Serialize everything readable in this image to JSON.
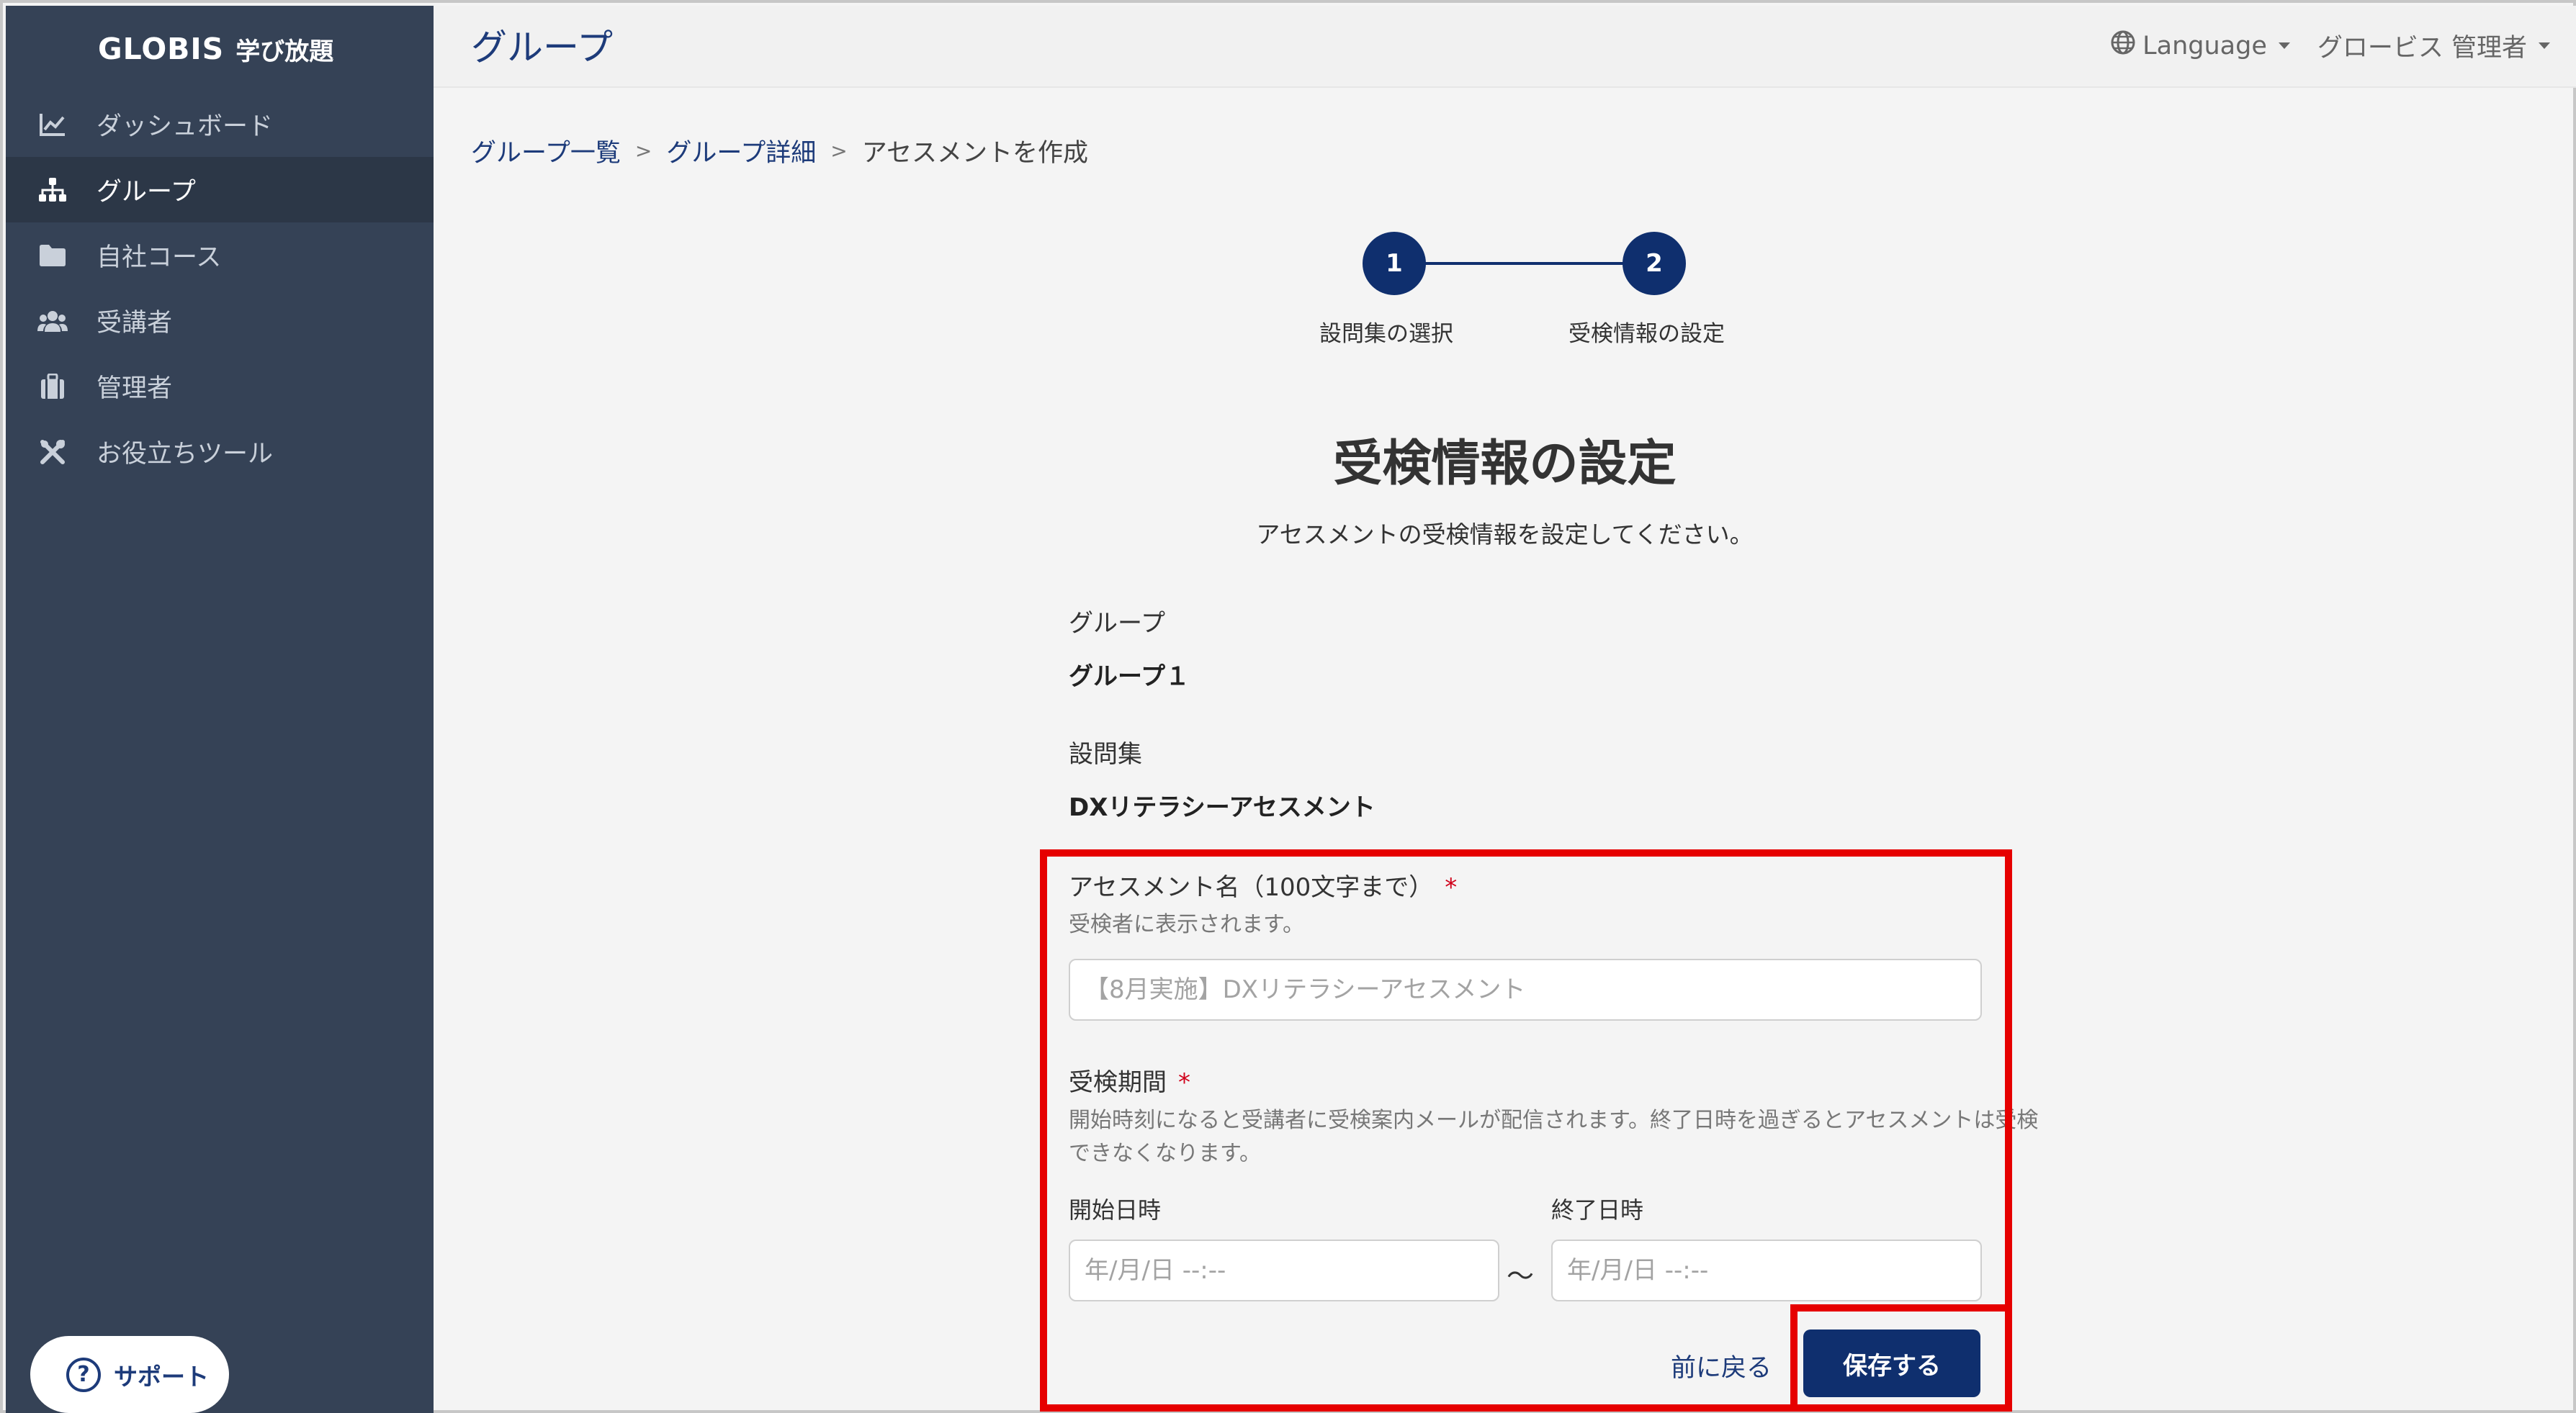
{
  "app": {
    "brand": "GLOBIS",
    "brand_sub": "学び放題"
  },
  "sidebar": {
    "items": [
      {
        "label": "ダッシュボード",
        "icon": "chart-line-icon",
        "active": false
      },
      {
        "label": "グループ",
        "icon": "sitemap-icon",
        "active": true
      },
      {
        "label": "自社コース",
        "icon": "folder-icon",
        "active": false
      },
      {
        "label": "受講者",
        "icon": "users-icon",
        "active": false
      },
      {
        "label": "管理者",
        "icon": "briefcase-icon",
        "active": false
      },
      {
        "label": "お役立ちツール",
        "icon": "tools-icon",
        "active": false
      }
    ],
    "support_label": "サポート"
  },
  "header": {
    "title": "グループ",
    "language_label": "Language",
    "user_label": "グロービス 管理者"
  },
  "breadcrumb": {
    "items": [
      "グループ一覧",
      "グループ詳細"
    ],
    "current": "アセスメントを作成",
    "separator": ">"
  },
  "stepper": {
    "steps": [
      {
        "number": "1",
        "label": "設問集の選択"
      },
      {
        "number": "2",
        "label": "受検情報の設定"
      }
    ]
  },
  "form": {
    "title": "受検情報の設定",
    "description": "アセスメントの受検情報を設定してください。",
    "group_label": "グループ",
    "group_value": "グループ１",
    "question_set_label": "設問集",
    "question_set_value": "DXリテラシーアセスメント",
    "assessment_name_label": "アセスメント名（100文字まで）",
    "required_mark": "*",
    "assessment_name_hint": "受検者に表示されます。",
    "assessment_name_placeholder": "【8月実施】DXリテラシーアセスメント",
    "period_label": "受検期間",
    "period_hint_line1": "開始時刻になると受講者に受検案内メールが配信されます。終了日時を過ぎるとアセスメントは受検",
    "period_hint_line2": "できなくなります。",
    "start_label": "開始日時",
    "end_label": "終了日時",
    "datetime_placeholder": "年/月/日 --:--",
    "range_separator": "～",
    "back_label": "前に戻る",
    "save_label": "保存する"
  },
  "colors": {
    "sidebar": "#354256",
    "primary": "#0f2f6e",
    "highlight": "#e60000"
  }
}
